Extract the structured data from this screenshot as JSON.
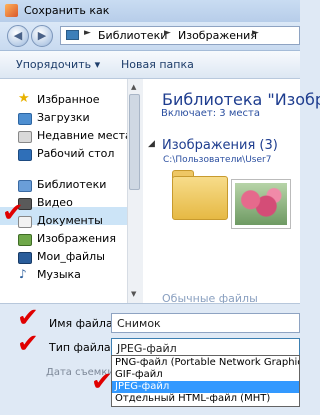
{
  "window": {
    "title": "Сохранить как"
  },
  "address": {
    "crumbs": [
      "Библиотеки",
      "Изображения"
    ]
  },
  "toolbar": {
    "organize": "Упорядочить ▾",
    "new_folder": "Новая папка"
  },
  "sidebar": {
    "favorites": {
      "header": "Избранное",
      "items": [
        "Загрузки",
        "Недавние места",
        "Рабочий стол"
      ]
    },
    "libraries": {
      "header": "Библиотеки",
      "items": [
        "Видео",
        "Документы",
        "Изображения",
        "Мои_файлы",
        "Музыка"
      ]
    }
  },
  "main": {
    "library_title": "Библиотека \"Изобр",
    "includes_label": "Включает:",
    "places": "3 места",
    "group_title": "Изображения (3)",
    "group_path": "C:\\Пользователи\\User7",
    "hidden_text": "Обычные файлы"
  },
  "form": {
    "filename_label": "Имя файла:",
    "filename_value": "Снимок",
    "filetype_label": "Тип файла:",
    "filetype_value": "JPEG-файл",
    "date_label": "Дата съемки:",
    "options": [
      "PNG-файл (Portable Network Graphic)",
      "GIF-файл",
      "JPEG-файл",
      "Отдельный HTML-файл (MHT)"
    ],
    "selected_option": "JPEG-файл"
  },
  "colors": {
    "accent": "#3399ff",
    "link": "#1e3d8f",
    "mark": "#e00000"
  }
}
